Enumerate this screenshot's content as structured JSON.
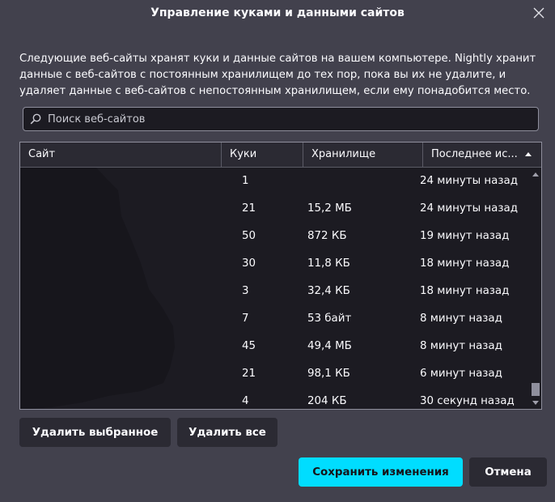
{
  "dialog": {
    "title": "Управление куками и данными сайтов",
    "description": "Следующие веб-сайты хранят куки и данные сайтов на вашем компьютере. Nightly хранит данные с веб-сайтов с постоянным хранилищем до тех пор, пока вы их не удалите, и удаляет данные с веб-сайтов с непостоянным хранилищем, если ему понадобится место."
  },
  "search": {
    "placeholder": "Поиск веб-сайтов",
    "value": ""
  },
  "table": {
    "columns": {
      "site": "Сайт",
      "cookies": "Куки",
      "storage": "Хранилище",
      "last_used": "Последнее ис..."
    },
    "rows": [
      {
        "site": "",
        "cookies": "1",
        "storage": "",
        "last_used": "24 минуты назад"
      },
      {
        "site": "",
        "cookies": "21",
        "storage": "15,2 МБ",
        "last_used": "24 минуты назад"
      },
      {
        "site": "",
        "cookies": "50",
        "storage": "872 КБ",
        "last_used": "19 минут назад"
      },
      {
        "site": "",
        "cookies": "30",
        "storage": "11,8 КБ",
        "last_used": "18 минут назад"
      },
      {
        "site": "",
        "cookies": "3",
        "storage": "32,4 КБ",
        "last_used": "18 минут назад"
      },
      {
        "site": "",
        "cookies": "7",
        "storage": "53 байт",
        "last_used": "8 минут назад"
      },
      {
        "site": "",
        "cookies": "45",
        "storage": "49,4 МБ",
        "last_used": "8 минут назад"
      },
      {
        "site": "",
        "cookies": "21",
        "storage": "98,1 КБ",
        "last_used": "6 минут назад"
      },
      {
        "site": "",
        "cookies": "4",
        "storage": "204 КБ",
        "last_used": "30 секунд назад"
      }
    ]
  },
  "buttons": {
    "remove_selected": "Удалить выбранное",
    "remove_all": "Удалить все",
    "save": "Сохранить изменения",
    "cancel": "Отмена"
  },
  "colors": {
    "background": "#42414d",
    "field": "#1c1b22",
    "accent": "#00ddff",
    "redaction": "#17161c"
  },
  "icons": {
    "close": "close-icon",
    "search": "search-icon",
    "sort": "sort-ascending-icon"
  }
}
